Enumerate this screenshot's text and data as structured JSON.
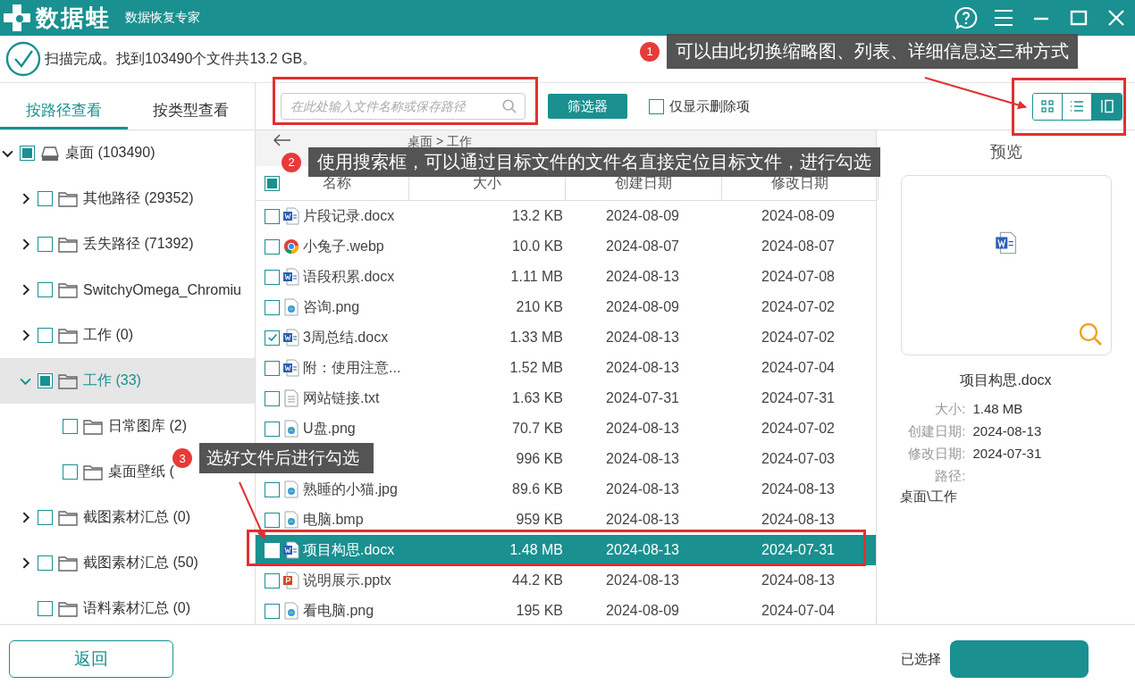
{
  "app": {
    "logo": "数据蛙",
    "subtitle": "数据恢复专家"
  },
  "scan_status": "扫描完成。找到103490个文件共13.2 GB。",
  "view_tabs": [
    {
      "label": "按路径查看",
      "selected": true
    },
    {
      "label": "按类型查看",
      "selected": false
    }
  ],
  "search": {
    "placeholder": "在此处输入文件名称或保存路径"
  },
  "filter_button": "筛选器",
  "deleted_only": {
    "label": "仅显示删除项",
    "checked": false
  },
  "view_modes": [
    {
      "kind": "grid",
      "selected": false
    },
    {
      "kind": "list",
      "selected": false
    },
    {
      "kind": "details",
      "selected": true
    }
  ],
  "breadcrumb": "桌面 > 工作",
  "tree": [
    {
      "label": "桌面 (103490)",
      "kind": "drive",
      "expanded": true,
      "partial": true,
      "selected": false,
      "children": [
        {
          "label": "其他路径 (29352)",
          "kind": "folder",
          "expanded": false,
          "partial": false,
          "selected": false
        },
        {
          "label": "丢失路径 (71392)",
          "kind": "folder",
          "expanded": false,
          "partial": false,
          "selected": false
        },
        {
          "label": "SwitchyOmega_Chromiu",
          "kind": "folder",
          "expanded": false,
          "partial": false,
          "selected": false
        },
        {
          "label": "工作 (0)",
          "kind": "folder",
          "expanded": false,
          "partial": false,
          "selected": false
        },
        {
          "label": "工作 (33)",
          "kind": "folder",
          "expanded": true,
          "partial": true,
          "selected": true,
          "children": [
            {
              "label": "日常图库 (2)",
              "kind": "folder",
              "partial": false,
              "selected": false
            },
            {
              "label": "桌面壁纸 (",
              "kind": "folder",
              "partial": false,
              "selected": false
            }
          ]
        },
        {
          "label": "截图素材汇总 (0)",
          "kind": "folder",
          "expanded": false,
          "partial": false,
          "selected": false
        },
        {
          "label": "截图素材汇总 (50)",
          "kind": "folder",
          "expanded": false,
          "partial": false,
          "selected": false
        },
        {
          "label": "语料素材汇总 (0)",
          "kind": "folder",
          "partial": false,
          "selected": false
        }
      ]
    }
  ],
  "table": {
    "header_partial": true,
    "columns": [
      "名称",
      "大小",
      "创建日期",
      "修改日期"
    ],
    "rows": [
      {
        "name": "片段记录.docx",
        "kind": "word",
        "size": "13.2 KB",
        "created": "2024-08-09",
        "modified": "2024-08-09",
        "checked": false,
        "selected": false
      },
      {
        "name": "小兔子.webp",
        "kind": "browser",
        "size": "10.0 KB",
        "created": "2024-08-07",
        "modified": "2024-08-07",
        "checked": false,
        "selected": false
      },
      {
        "name": "语段积累.docx",
        "kind": "word",
        "size": "1.11 MB",
        "created": "2024-08-13",
        "modified": "2024-07-08",
        "checked": false,
        "selected": false
      },
      {
        "name": "咨询.png",
        "kind": "image",
        "size": "210 KB",
        "created": "2024-08-09",
        "modified": "2024-07-02",
        "checked": false,
        "selected": false
      },
      {
        "name": "3周总结.docx",
        "kind": "word",
        "size": "1.33 MB",
        "created": "2024-08-13",
        "modified": "2024-07-02",
        "checked": true,
        "selected": false
      },
      {
        "name": "附：使用注意...",
        "kind": "word",
        "size": "1.52 MB",
        "created": "2024-08-13",
        "modified": "2024-07-04",
        "checked": false,
        "selected": false
      },
      {
        "name": "网站链接.txt",
        "kind": "text",
        "size": "1.63 KB",
        "created": "2024-07-31",
        "modified": "2024-07-31",
        "checked": false,
        "selected": false
      },
      {
        "name": "U盘.png",
        "kind": "image",
        "size": "70.7 KB",
        "created": "2024-08-13",
        "modified": "2024-07-02",
        "checked": false,
        "selected": false
      },
      {
        "size": "996 KB",
        "created": "2024-08-13",
        "modified": "2024-07-03",
        "selected": false
      },
      {
        "name": "熟睡的小猫.jpg",
        "kind": "image",
        "size": "89.6 KB",
        "created": "2024-08-13",
        "modified": "2024-08-13",
        "checked": false,
        "selected": false
      },
      {
        "name": "电脑.bmp",
        "kind": "image",
        "size": "959 KB",
        "created": "2024-08-13",
        "modified": "2024-08-13",
        "checked": false,
        "selected": false
      },
      {
        "name": "项目构思.docx",
        "kind": "word",
        "size": "1.48 MB",
        "created": "2024-08-13",
        "modified": "2024-07-31",
        "checked": false,
        "selected": true
      },
      {
        "name": "说明展示.pptx",
        "kind": "slides",
        "size": "44.2 KB",
        "created": "2024-08-13",
        "modified": "2024-08-13",
        "checked": false,
        "selected": false
      },
      {
        "name": "看电脑.png",
        "kind": "image",
        "size": "195 KB",
        "created": "2024-08-09",
        "modified": "2024-07-04",
        "checked": false,
        "selected": false
      }
    ]
  },
  "preview": {
    "title": "预览",
    "kind": "word",
    "file_name": "项目构思.docx",
    "fields": [
      {
        "label": "大小:",
        "value": "1.48 MB"
      },
      {
        "label": "创建日期:",
        "value": "2024-08-13"
      },
      {
        "label": "修改日期:",
        "value": "2024-07-31"
      }
    ],
    "path_label": "路径:",
    "path": "桌面\\工作"
  },
  "footer": {
    "back_button": "返回",
    "selected_text": "已选择"
  },
  "annotations": [
    {
      "number": "1",
      "text": "可以由此切换缩略图、列表、详细信息这三种方式"
    },
    {
      "number": "2",
      "text": "使用搜索框，可以通过目标文件的文件名直接定位目标文件，进行勾选"
    },
    {
      "number": "3",
      "text": "选好文件后进行勾选"
    }
  ]
}
